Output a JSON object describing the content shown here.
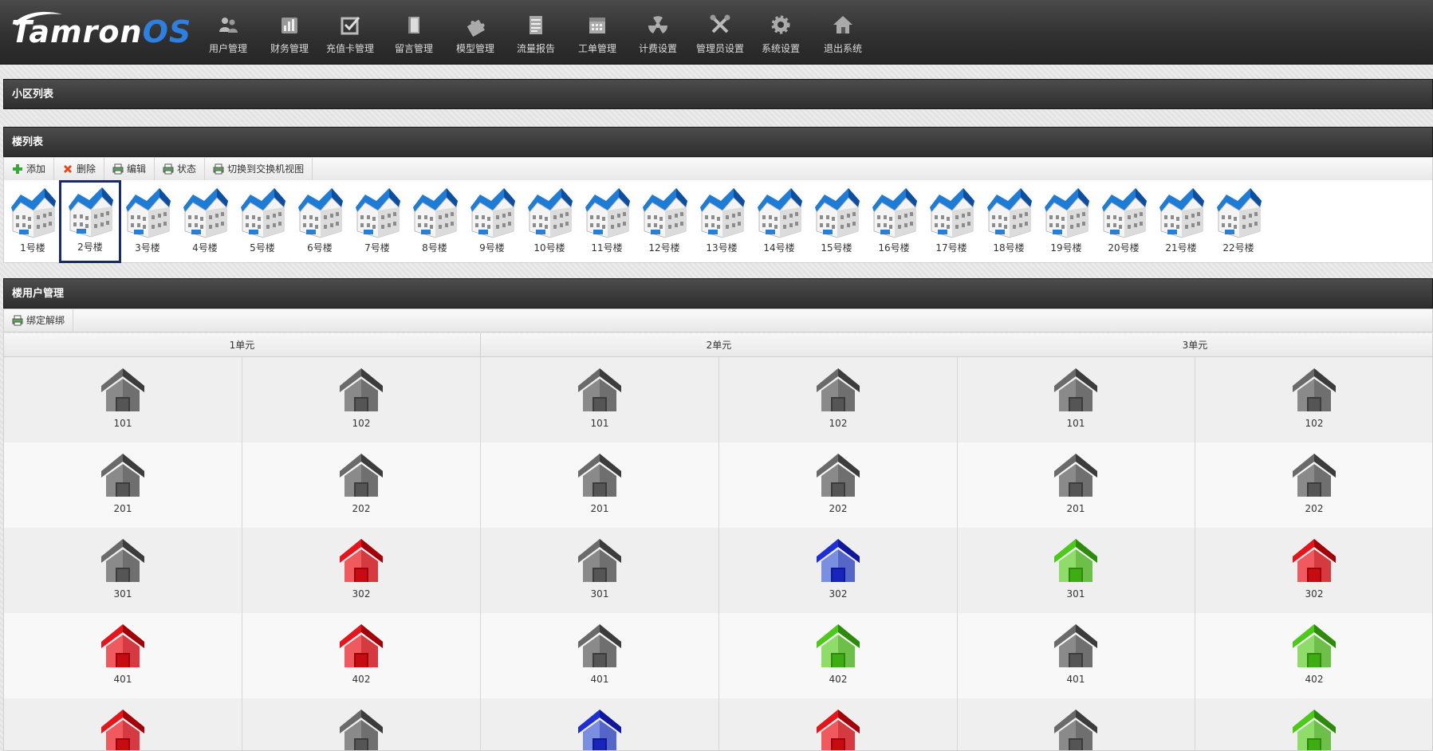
{
  "app": {
    "logo_main": "Tamron",
    "logo_suffix": "OS"
  },
  "nav": [
    {
      "label": "用户管理",
      "icon": "users-icon"
    },
    {
      "label": "财务管理",
      "icon": "bar-chart-icon"
    },
    {
      "label": "充值卡管理",
      "icon": "checkbox-icon"
    },
    {
      "label": "留言管理",
      "icon": "book-icon"
    },
    {
      "label": "模型管理",
      "icon": "puzzle-icon"
    },
    {
      "label": "流量报告",
      "icon": "report-icon"
    },
    {
      "label": "工单管理",
      "icon": "calendar-icon"
    },
    {
      "label": "计费设置",
      "icon": "radiation-icon"
    },
    {
      "label": "管理员设置",
      "icon": "tools-icon"
    },
    {
      "label": "系统设置",
      "icon": "gear-icon"
    },
    {
      "label": "退出系统",
      "icon": "home-icon"
    }
  ],
  "panels": {
    "community": {
      "title": "小区列表"
    },
    "buildings": {
      "title": "楼列表"
    },
    "households": {
      "title": "楼用户管理"
    }
  },
  "building_toolbar": {
    "add": "添加",
    "delete": "删除",
    "edit": "编辑",
    "status": "状态",
    "switch_view": "切换到交换机视图"
  },
  "household_toolbar": {
    "bind": "绑定解绑"
  },
  "buildings": [
    "1号楼",
    "2号楼",
    "3号楼",
    "4号楼",
    "5号楼",
    "6号楼",
    "7号楼",
    "8号楼",
    "9号楼",
    "10号楼",
    "11号楼",
    "12号楼",
    "13号楼",
    "14号楼",
    "15号楼",
    "16号楼",
    "17号楼",
    "18号楼",
    "19号楼",
    "20号楼",
    "21号楼",
    "22号楼"
  ],
  "selected_building": "2号楼",
  "colors": {
    "gray": "#6a6a6a",
    "red": "#e8141b",
    "blue": "#1f2fd6",
    "green": "#4cc919",
    "selection": "#1a2a66"
  },
  "units": [
    "1单元",
    "2单元",
    "3单元"
  ],
  "rows": [
    [
      {
        "room": "101",
        "status": "gray"
      },
      {
        "room": "102",
        "status": "gray"
      },
      {
        "room": "101",
        "status": "gray"
      },
      {
        "room": "102",
        "status": "gray"
      },
      {
        "room": "101",
        "status": "gray"
      },
      {
        "room": "102",
        "status": "gray"
      }
    ],
    [
      {
        "room": "201",
        "status": "gray"
      },
      {
        "room": "202",
        "status": "gray"
      },
      {
        "room": "201",
        "status": "gray"
      },
      {
        "room": "202",
        "status": "gray"
      },
      {
        "room": "201",
        "status": "gray"
      },
      {
        "room": "202",
        "status": "gray"
      }
    ],
    [
      {
        "room": "301",
        "status": "gray"
      },
      {
        "room": "302",
        "status": "red"
      },
      {
        "room": "301",
        "status": "gray"
      },
      {
        "room": "302",
        "status": "blue"
      },
      {
        "room": "301",
        "status": "green"
      },
      {
        "room": "302",
        "status": "red"
      }
    ],
    [
      {
        "room": "401",
        "status": "red"
      },
      {
        "room": "402",
        "status": "red"
      },
      {
        "room": "401",
        "status": "gray"
      },
      {
        "room": "402",
        "status": "green"
      },
      {
        "room": "401",
        "status": "gray"
      },
      {
        "room": "402",
        "status": "green"
      }
    ],
    [
      {
        "room": "",
        "status": "red"
      },
      {
        "room": "",
        "status": "gray"
      },
      {
        "room": "",
        "status": "blue"
      },
      {
        "room": "",
        "status": "red"
      },
      {
        "room": "",
        "status": "gray"
      },
      {
        "room": "",
        "status": "green"
      }
    ]
  ]
}
